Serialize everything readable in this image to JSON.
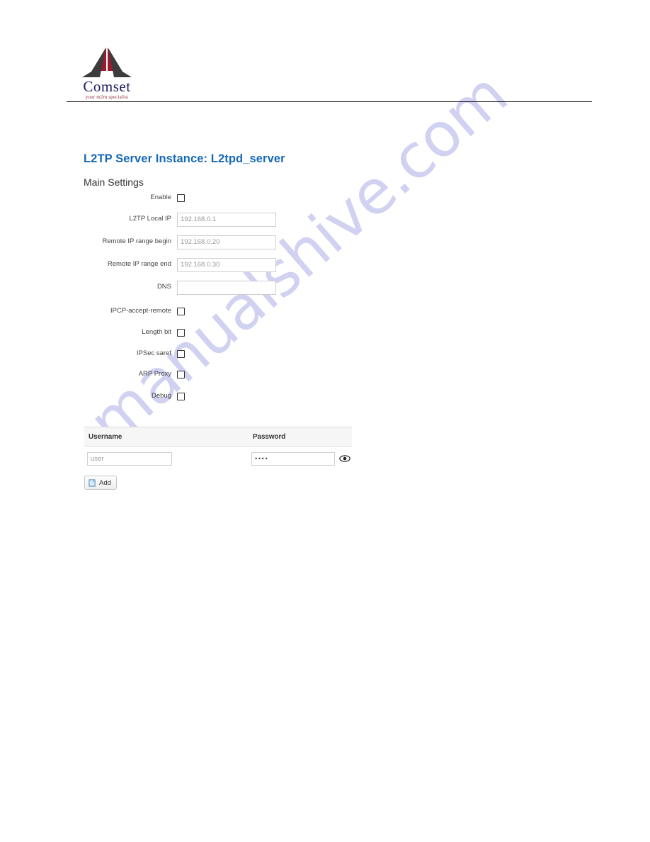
{
  "brand": {
    "name": "Comset",
    "tagline": "your m2m specialist",
    "logo_icon": "comset-triangle-logo",
    "red": "#9b1b30",
    "dark": "#3c3c3c",
    "word_color": "#20205e"
  },
  "header": {
    "title": "L2TP Server Instance: L2tpd_server",
    "title_color": "#1669b8",
    "section": "Main Settings"
  },
  "watermark": {
    "text": "manualshive.com",
    "color": "#c9c9ef"
  },
  "form": {
    "fields": [
      {
        "label": "Enable",
        "type": "checkbox",
        "checked": false
      },
      {
        "label": "L2TP Local IP",
        "type": "text",
        "value": "192.168.0.1"
      },
      {
        "label": "Remote IP range begin",
        "type": "text",
        "value": "192.168.0.20"
      },
      {
        "label": "Remote IP range end",
        "type": "text",
        "value": "192.168.0.30"
      },
      {
        "label": "DNS",
        "type": "text",
        "value": ""
      },
      {
        "label": "IPCP-accept-remote",
        "type": "checkbox",
        "checked": false
      },
      {
        "label": "Length bit",
        "type": "checkbox",
        "checked": false
      },
      {
        "label": "IPSec saref",
        "type": "checkbox",
        "checked": false
      },
      {
        "label": "ARP Proxy",
        "type": "checkbox",
        "checked": false
      },
      {
        "label": "Debug",
        "type": "checkbox",
        "checked": false
      }
    ]
  },
  "users_table": {
    "columns": [
      "Username",
      "Password"
    ],
    "rows": [
      {
        "username": "user",
        "password": "••••"
      }
    ],
    "reveal_icon": "eye-icon"
  },
  "actions": {
    "add_label": "Add",
    "add_icon": "add-page-icon"
  }
}
